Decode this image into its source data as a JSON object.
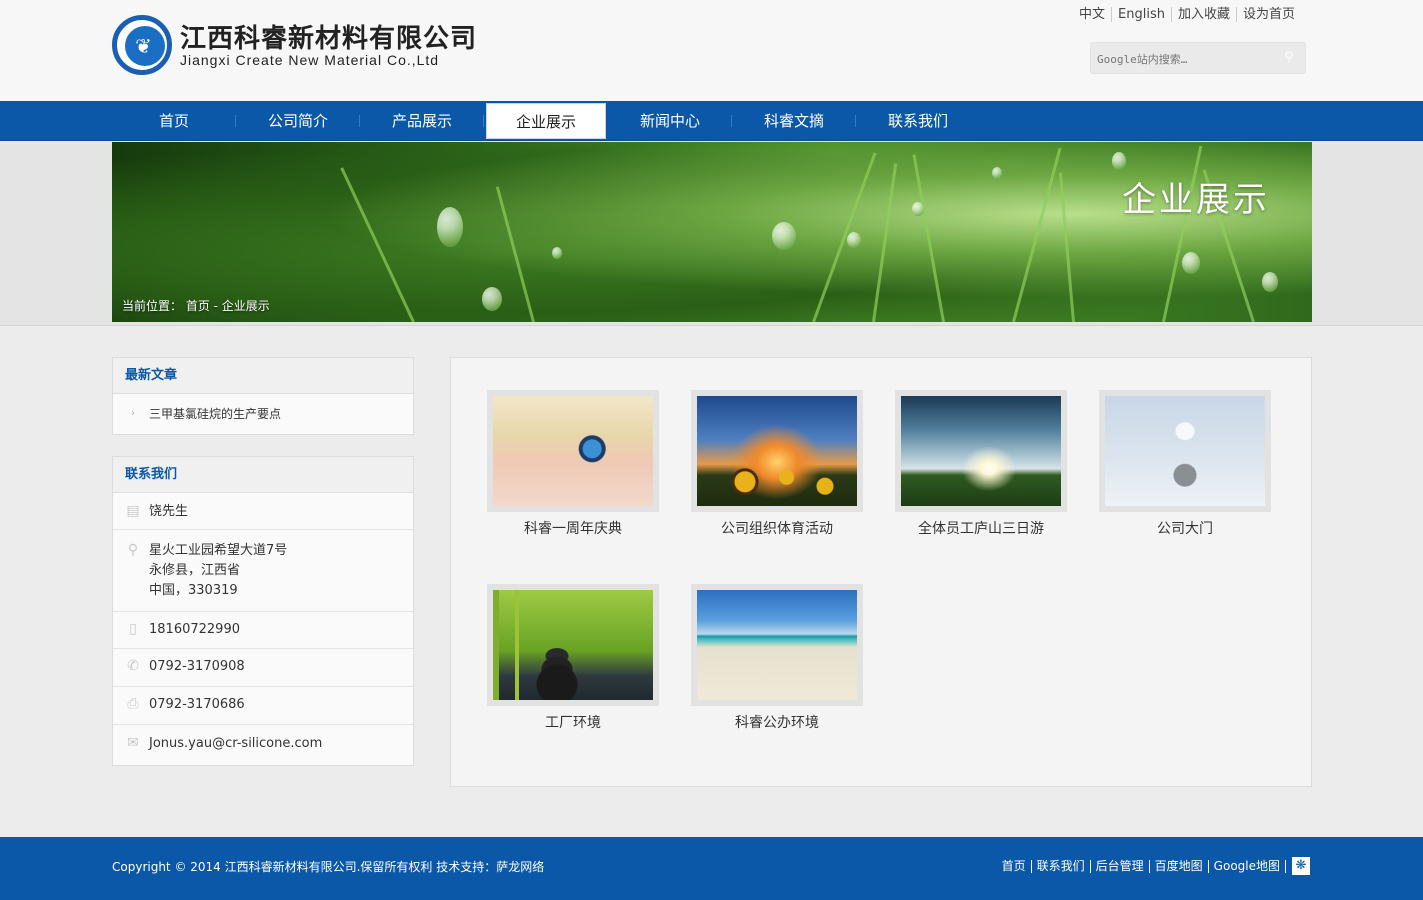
{
  "header": {
    "logo_cn": "江西科睿新材料有限公司",
    "logo_en": "Jiangxi Create New Material Co.,Ltd",
    "top_links": [
      "中文",
      "English",
      "加入收藏",
      "设为首页"
    ],
    "search_placeholder": "Google站内搜索…"
  },
  "nav": {
    "items": [
      "首页",
      "公司简介",
      "产品展示",
      "企业展示",
      "新闻中心",
      "科睿文摘",
      "联系我们"
    ],
    "active": "企业展示"
  },
  "banner": {
    "title": "企业展示",
    "breadcrumb": "当前位置： 首页 - 企业展示"
  },
  "sidebar": {
    "articles_title": "最新文章",
    "articles": [
      "三甲基氯硅烷的生产要点"
    ],
    "contact_title": "联系我们",
    "contact_name": "饶先生",
    "address_line1": "星火工业园希望大道7号",
    "address_line2": "永修县，江西省",
    "address_line3": "中国，330319",
    "mobile": "18160722990",
    "phone": "0792-3170908",
    "fax": "0792-3170686",
    "email": "Jonus.yau@cr-silicone.com"
  },
  "gallery": {
    "items": [
      {
        "caption": "科睿一周年庆典"
      },
      {
        "caption": "公司组织体育活动"
      },
      {
        "caption": "全体员工庐山三日游"
      },
      {
        "caption": "公司大门"
      },
      {
        "caption": "工厂环境"
      },
      {
        "caption": "科睿公办环境"
      }
    ]
  },
  "footer": {
    "copyright": "Copyright © 2014 江西科睿新材料有限公司.保留所有权利 技术支持：萨龙网络",
    "links": [
      "首页",
      "联系我们",
      "后台管理",
      "百度地图",
      "Google地图"
    ]
  },
  "colors": {
    "brand_blue": "#0b58a8",
    "nav_active_bg": "#ffffff"
  }
}
